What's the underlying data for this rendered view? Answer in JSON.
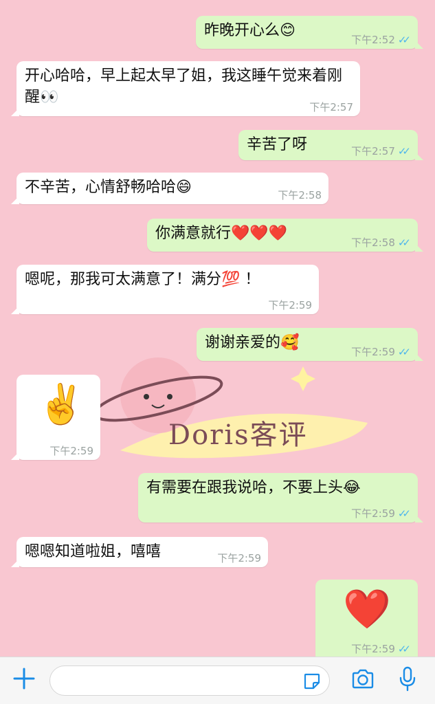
{
  "messages": [
    {
      "dir": "out",
      "text": "昨晚开心么😊",
      "time": "下午2:52"
    },
    {
      "dir": "in",
      "text": "开心哈哈，早上起太早了姐，我这睡午觉来着刚醒👀",
      "time": "下午2:57"
    },
    {
      "dir": "out",
      "text": "辛苦了呀",
      "time": "下午2:57"
    },
    {
      "dir": "in",
      "text": "不辛苦，心情舒畅哈哈😄",
      "time": "下午2:58"
    },
    {
      "dir": "out",
      "text": "你满意就行❤️❤️❤️",
      "time": "下午2:58"
    },
    {
      "dir": "in",
      "text": "嗯呢，那我可太满意了！满分💯 ！",
      "time": "下午2:59"
    },
    {
      "dir": "out",
      "text": "谢谢亲爱的🥰",
      "time": "下午2:59"
    },
    {
      "dir": "in",
      "text": "✌️",
      "time": "下午2:59"
    },
    {
      "dir": "out",
      "text": "有需要在跟我说哈，不要上头😂",
      "time": "下午2:59"
    },
    {
      "dir": "in",
      "text": "嗯嗯知道啦姐，嘻嘻",
      "time": "下午2:59"
    },
    {
      "dir": "out",
      "text": "❤️",
      "time": "下午2:59"
    }
  ],
  "watermark": {
    "text": "Doris客评"
  },
  "input": {
    "placeholder": "",
    "value": ""
  },
  "icons": {
    "plus": "plus-icon",
    "sticker": "sticker-icon",
    "camera": "camera-icon",
    "mic": "microphone-icon",
    "read_receipt": "double-check-icon"
  },
  "colors": {
    "wallpaper": "#f9c7d1",
    "incoming_bubble": "#ffffff",
    "outgoing_bubble": "#dcf8c6",
    "accent": "#1a8ce6",
    "read_ticks": "#4fb6ec"
  }
}
